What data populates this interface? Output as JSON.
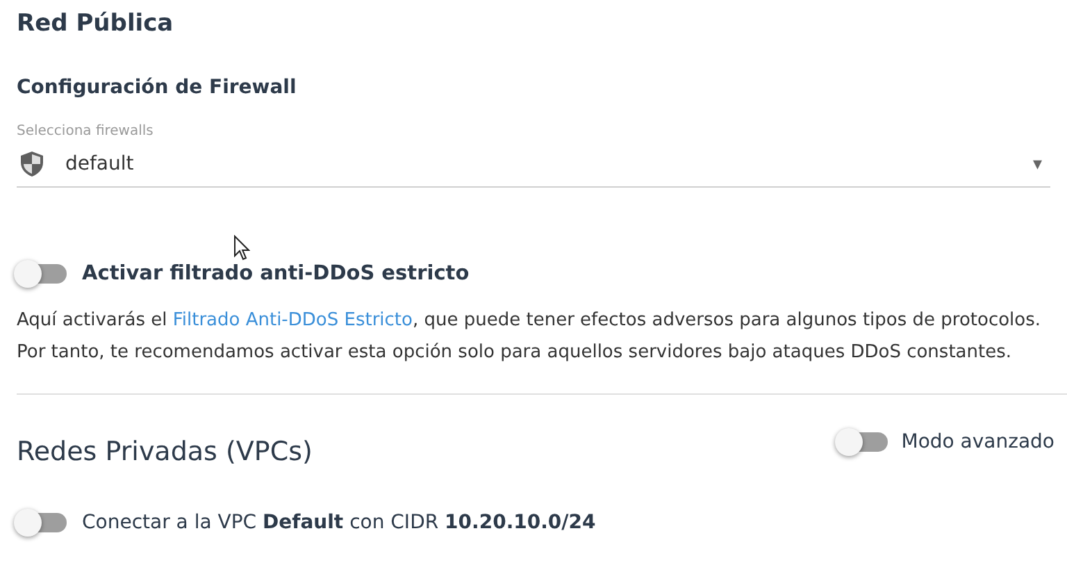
{
  "public_network": {
    "title": "Red Pública",
    "firewall_title": "Configuración de Firewall",
    "firewall_select": {
      "label": "Selecciona firewalls",
      "value": "default",
      "caret": "▾"
    },
    "ddos_toggle": {
      "label": "Activar filtrado anti-DDoS estricto",
      "on": false
    },
    "description": {
      "before": "Aquí activarás el ",
      "link": "Filtrado Anti-DDoS Estricto",
      "after": ", que puede tener efectos adversos para algunos tipos de protocolos. Por tanto, te recomendamos activar esta opción solo para aquellos servidores bajo ataques DDoS constantes."
    }
  },
  "private_networks": {
    "title": "Redes Privadas (VPCs)",
    "advanced_toggle": {
      "label": "Modo avanzado",
      "on": false
    },
    "vpcs": [
      {
        "label": "Conectar a la VPC **Default** con CIDR **10.20.10.0/24**",
        "on": false
      }
    ]
  }
}
